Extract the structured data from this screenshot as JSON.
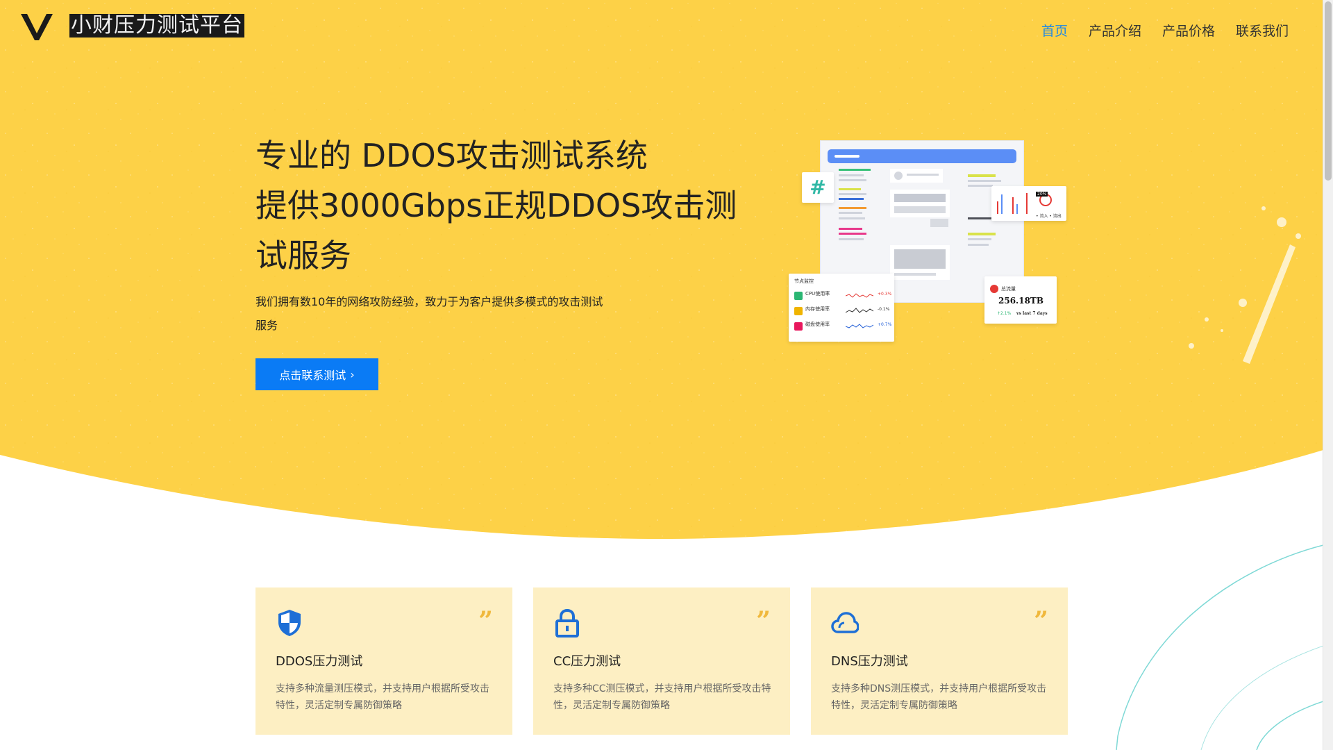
{
  "header": {
    "brand": "小财压力测试平台",
    "nav": [
      {
        "label": "首页",
        "active": true
      },
      {
        "label": "产品介绍",
        "active": false
      },
      {
        "label": "产品价格",
        "active": false
      },
      {
        "label": "联系我们",
        "active": false
      }
    ]
  },
  "hero": {
    "title_line1": "专业的 DDOS攻击测试系统",
    "title_line2": "提供3000Gbps正规DDOS攻击测",
    "title_line3": "试服务",
    "desc_line1": "我们拥有数10年的网络攻防经验，致力于为客户提供多模式的攻击测试",
    "desc_line2": "服务",
    "cta_label": "点击联系测试",
    "cta_arrow": "›"
  },
  "illustration": {
    "monitor_title": "节点监控",
    "rows": [
      {
        "label": "CPU使用率",
        "value": "+0.3%",
        "color": "#e53935",
        "badge": "#2bb673"
      },
      {
        "label": "内存使用率",
        "value": "-0.1%",
        "color": "#333333",
        "badge": "#f0b400"
      },
      {
        "label": "磁盘使用率",
        "value": "+0.7%",
        "color": "#1e5bd6",
        "badge": "#e8175d"
      }
    ],
    "traffic_label": "总流量",
    "traffic_value": "256.18TB",
    "traffic_change": "↑2.1%",
    "traffic_period": "vs last 7 days",
    "mini_legend": "• 流入 • 流出",
    "mini_badge": "20%"
  },
  "cards": [
    {
      "icon": "shield-icon",
      "title": "DDOS压力测试",
      "desc": "支持多种流量测压模式，并支持用户根据所受攻击特性，灵活定制专属防御策略",
      "quote": "”"
    },
    {
      "icon": "lock-icon",
      "title": "CC压力测试",
      "desc": "支持多种CC测压模式，并支持用户根据所受攻击特性，灵活定制专属防御策略",
      "quote": "”"
    },
    {
      "icon": "cloud-icon",
      "title": "DNS压力测试",
      "desc": "支持多种DNS测压模式，并支持用户根据所受攻击特性，灵活定制专属防御策略",
      "quote": "”"
    }
  ],
  "colors": {
    "hero_yellow": "#fdd147",
    "accent_blue": "#0a7bf5",
    "card_bg": "#fdefc3",
    "quote_gold": "#f0b83c",
    "teal_line": "#7fd9d6"
  }
}
